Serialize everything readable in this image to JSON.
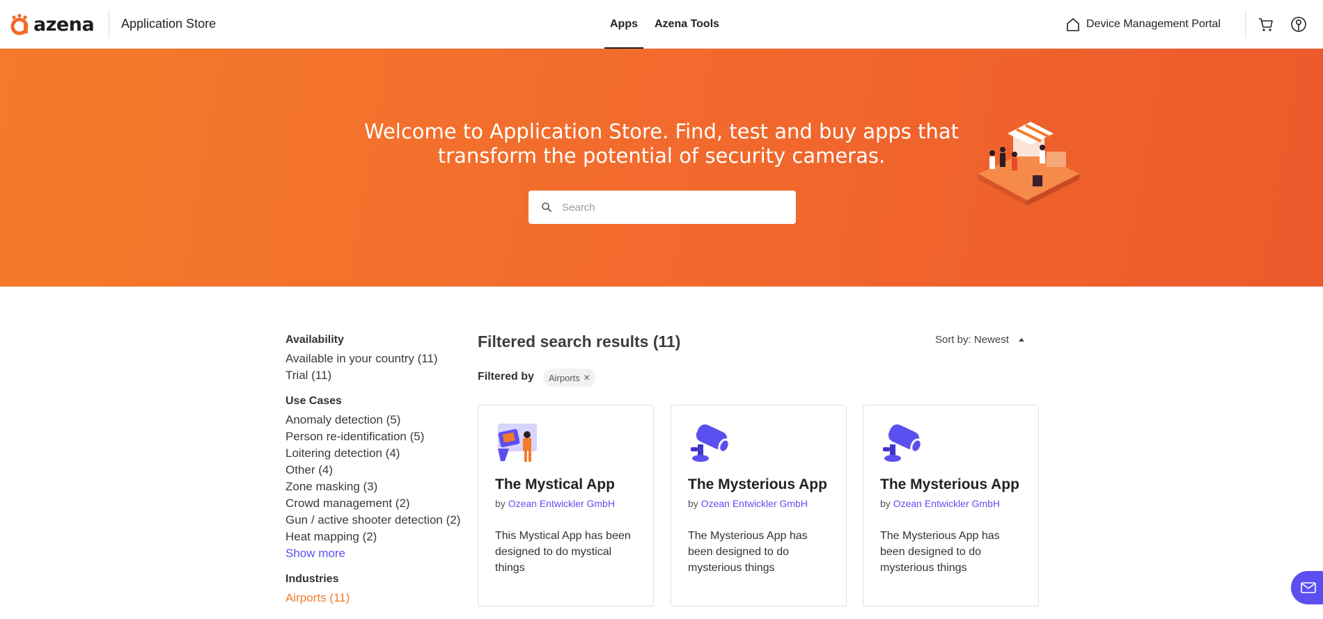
{
  "header": {
    "logo_text": "azena",
    "app_title": "Application Store",
    "tabs": [
      {
        "label": "Apps",
        "active": true
      },
      {
        "label": "Azena Tools",
        "active": false
      }
    ],
    "portal_label": "Device Management Portal",
    "cart_icon": "cart-icon",
    "user_icon": "user-circle-icon"
  },
  "hero": {
    "title": "Welcome to Application Store. Find, test and buy apps that transform the potential of security cameras.",
    "search_placeholder": "Search",
    "search_value": ""
  },
  "sidebar": {
    "availability": {
      "heading": "Availability",
      "items": [
        "Available in your country (11)",
        "Trial (11)"
      ]
    },
    "use_cases": {
      "heading": "Use Cases",
      "items": [
        "Anomaly detection (5)",
        "Person re-identification (5)",
        "Loitering detection (4)",
        "Other (4)",
        "Zone masking (3)",
        "Crowd management (2)",
        "Gun / active shooter detection (2)",
        "Heat mapping (2)"
      ],
      "show_more": "Show more"
    },
    "industries": {
      "heading": "Industries",
      "items": [
        "Airports (11)"
      ]
    }
  },
  "results": {
    "title": "Filtered search results (11)",
    "sort_label": "Sort by: Newest",
    "filtered_by_label": "Filtered by",
    "filter_chip": "Airports",
    "cards": [
      {
        "title": "The Mystical App",
        "by": "by",
        "developer": "Ozean Entwickler GmbH",
        "description": "This Mystical App has been designed to do mystical things",
        "icon": "mystical-app-icon"
      },
      {
        "title": "The Mysterious App",
        "by": "by",
        "developer": "Ozean Entwickler GmbH",
        "description": "The Mysterious App has been designed to do mysterious things",
        "icon": "security-camera-icon"
      },
      {
        "title": "The Mysterious App",
        "by": "by",
        "developer": "Ozean Entwickler GmbH",
        "description": "The Mysterious App has been designed to do mysterious things",
        "icon": "security-camera-icon"
      }
    ]
  },
  "colors": {
    "brand_orange": "#f47b2a",
    "accent_purple": "#5b4ff0"
  }
}
